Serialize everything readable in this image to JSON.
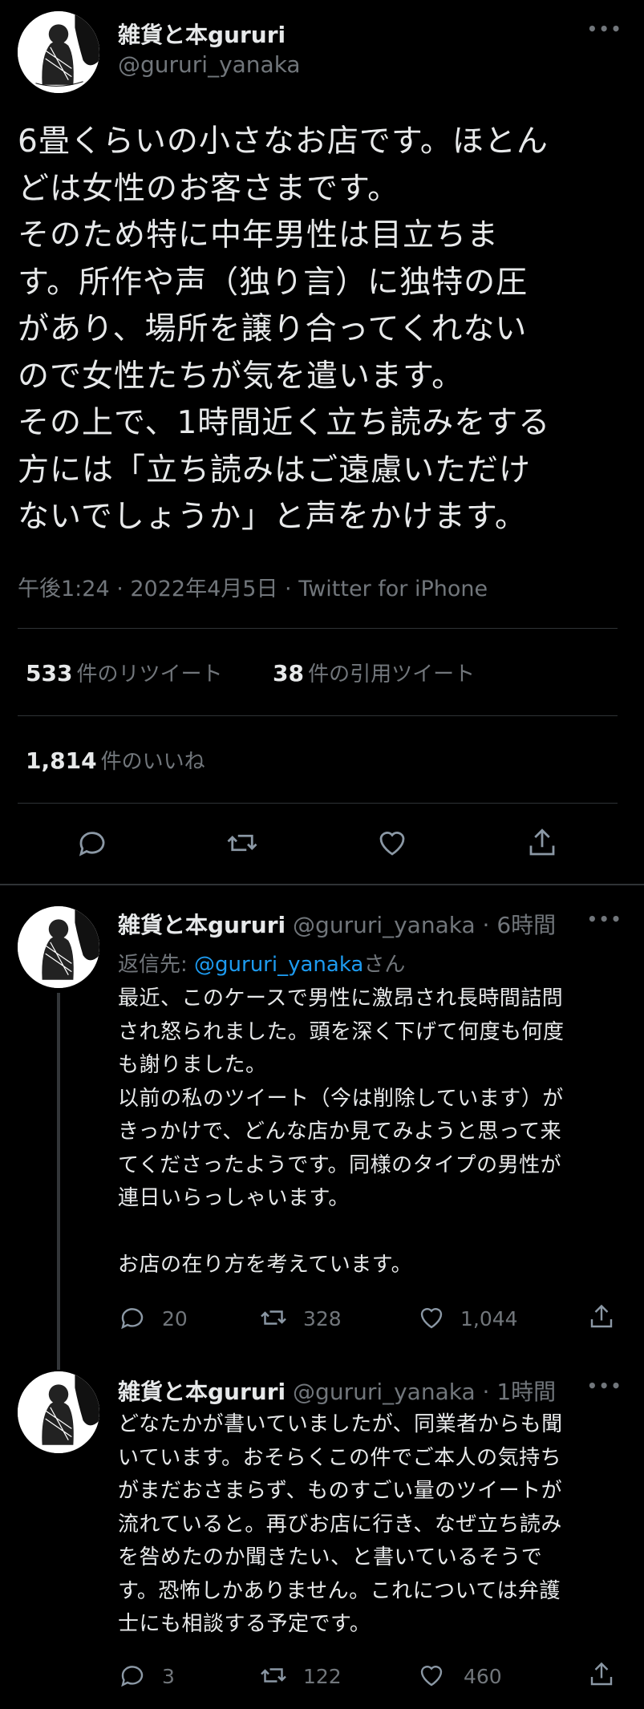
{
  "tweet": {
    "display_name": "雑貨と本gururi",
    "handle": "@gururi_yanaka",
    "more": "•••",
    "body": "6畳くらいの小さなお店です。ほとん\nどは女性のお客さまです。\nそのため特に中年男性は目立ちま\nす。所作や声（独り言）に独特の圧\nがあり、場所を譲り合ってくれない\nので女性たちが気を遣います。\nその上で、1時間近く立ち読みをする\n方には「立ち読みはご遠慮いただけ\nないでしょうか」と声をかけます。",
    "meta": "午後1:24 · 2022年4月5日 · Twitter for iPhone",
    "retweets_num": "533",
    "retweets_label": "件のリツイート",
    "quotes_num": "38",
    "quotes_label": "件の引用ツイート",
    "likes_num": "1,814",
    "likes_label": "件のいいね"
  },
  "replies": [
    {
      "display_name": "雑貨と本gururi",
      "handle": "@gururi_yanaka",
      "time": "· 6時間",
      "more": "•••",
      "reply_to_label": "返信先: ",
      "reply_to_handle": "@gururi_yanaka",
      "reply_to_suffix": "さん",
      "body": "最近、このケースで男性に激昂され長時間詰問\nされ怒られました。頭を深く下げて何度も何度\nも謝りました。\n以前の私のツイート（今は削除しています）が\nきっかけで、どんな店か見てみようと思って来\nてくださったようです。同様のタイプの男性が\n連日いらっしゃいます。\n\nお店の在り方を考えています。",
      "replies": "20",
      "retweets": "328",
      "likes": "1,044"
    },
    {
      "display_name": "雑貨と本gururi",
      "handle": "@gururi_yanaka",
      "time": "· 1時間",
      "more": "•••",
      "body": "どなたかが書いていましたが、同業者からも聞\nいています。おそらくこの件でご本人の気持ち\nがまだおさまらず、ものすごい量のツイートが\n流れていると。再びお店に行き、なぜ立ち読み\nを咎めたのか聞きたい、と書いているそうで\nす。恐怖しかありません。これについては弁護\n士にも相談する予定です。",
      "replies": "3",
      "retweets": "122",
      "likes": "460"
    }
  ],
  "avatar_caption": "gururi",
  "colors": {
    "background": "#000000",
    "text": "#e7e9ea",
    "secondary": "#71767b",
    "link": "#1d9bf0",
    "divider": "#2f3336"
  }
}
